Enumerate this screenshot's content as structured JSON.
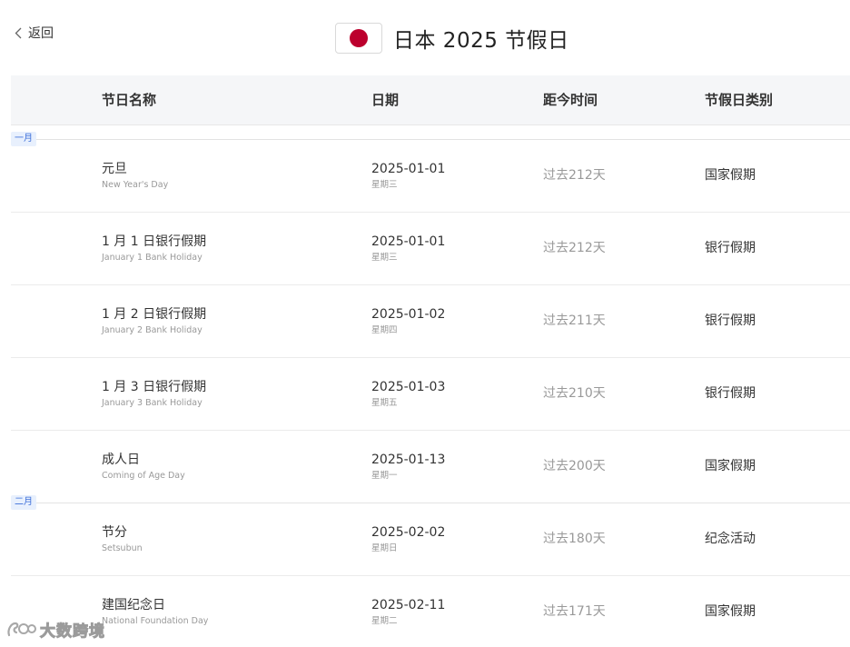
{
  "nav": {
    "back_label": "返回"
  },
  "page": {
    "title": "日本 2025 节假日"
  },
  "columns": [
    "节日名称",
    "日期",
    "距今时间",
    "节假日类别"
  ],
  "months": [
    "一月",
    "二月"
  ],
  "holidays": [
    {
      "name": "元旦",
      "name_en": "New Year's Day",
      "date": "2025-01-01",
      "weekday": "星期三",
      "since": "过去212天",
      "category": "国家假期"
    },
    {
      "name": "1 月 1 日银行假期",
      "name_en": "January 1 Bank Holiday",
      "date": "2025-01-01",
      "weekday": "星期三",
      "since": "过去212天",
      "category": "银行假期"
    },
    {
      "name": "1 月 2 日银行假期",
      "name_en": "January 2 Bank Holiday",
      "date": "2025-01-02",
      "weekday": "星期四",
      "since": "过去211天",
      "category": "银行假期"
    },
    {
      "name": "1 月 3 日银行假期",
      "name_en": "January 3 Bank Holiday",
      "date": "2025-01-03",
      "weekday": "星期五",
      "since": "过去210天",
      "category": "银行假期"
    },
    {
      "name": "成人日",
      "name_en": "Coming of Age Day",
      "date": "2025-01-13",
      "weekday": "星期一",
      "since": "过去200天",
      "category": "国家假期"
    },
    {
      "name": "节分",
      "name_en": "Setsubun",
      "date": "2025-02-02",
      "weekday": "星期日",
      "since": "过去180天",
      "category": "纪念活动"
    },
    {
      "name": "建国纪念日",
      "name_en": "National Foundation Day",
      "date": "2025-02-11",
      "weekday": "星期二",
      "since": "过去171天",
      "category": "国家假期"
    }
  ],
  "watermark": {
    "text": "大数跨境"
  }
}
